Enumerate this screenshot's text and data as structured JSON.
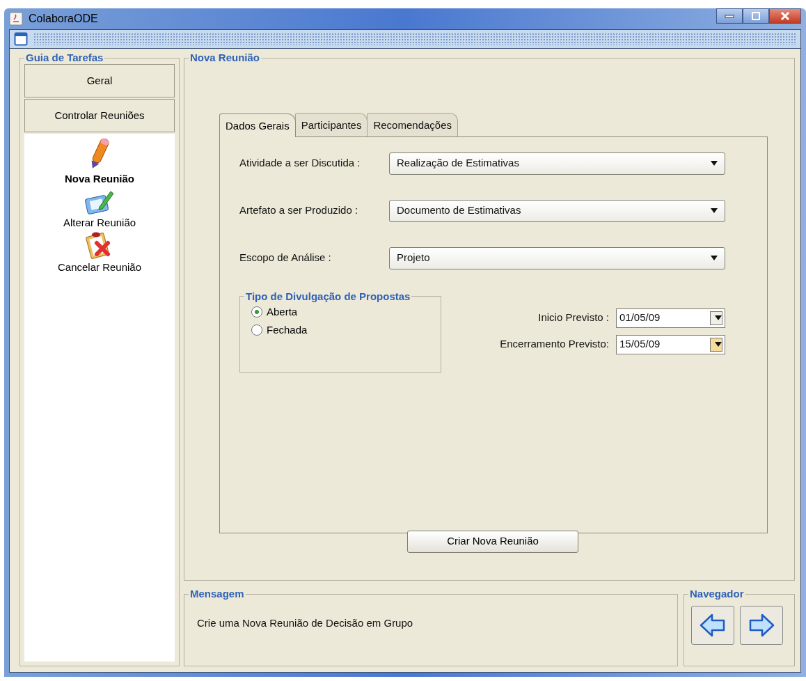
{
  "window": {
    "title": "ColaboraODE"
  },
  "task_guide": {
    "title": "Guia de Tarefas",
    "sections": [
      "Geral",
      "Controlar Reuniões"
    ],
    "tasks": [
      {
        "label": "Nova Reunião",
        "kind": "pencil",
        "selected": true
      },
      {
        "label": "Alterar Reunião",
        "kind": "edit",
        "selected": false
      },
      {
        "label": "Cancelar Reunião",
        "kind": "cancel",
        "selected": false
      }
    ]
  },
  "form": {
    "title": "Nova Reunião",
    "tabs": [
      {
        "label": "Dados Gerais",
        "selected": true
      },
      {
        "label": "Participantes",
        "selected": false
      },
      {
        "label": "Recomendações",
        "selected": false
      }
    ],
    "fields": [
      {
        "label": "Atividade a ser Discutida :",
        "value": "Realização de Estimativas"
      },
      {
        "label": "Artefato a ser Produzido :",
        "value": "Documento de Estimativas"
      },
      {
        "label": "Escopo de Análise :",
        "value": "Projeto"
      }
    ],
    "proposal_type": {
      "title": "Tipo de Divulgação de Propostas",
      "options": [
        {
          "label": "Aberta",
          "selected": true
        },
        {
          "label": "Fechada",
          "selected": false
        }
      ]
    },
    "dates": [
      {
        "label": "Inicio Previsto :",
        "value": "01/05/09"
      },
      {
        "label": "Encerramento Previsto:",
        "value": "15/05/09"
      }
    ],
    "submit": "Criar Nova Reunião"
  },
  "message": {
    "title": "Mensagem",
    "text": "Crie uma Nova Reunião de Decisão em Grupo"
  },
  "navigator": {
    "title": "Navegador"
  }
}
